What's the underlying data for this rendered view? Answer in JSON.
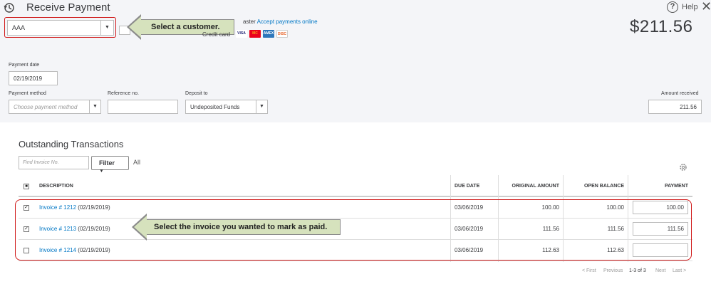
{
  "header": {
    "title": "Receive Payment",
    "help_label": "Help",
    "close_symbol": "✕",
    "amount_display": "$211.56"
  },
  "customer": {
    "value": "AAA",
    "callout": "Select a customer."
  },
  "payments_promo": {
    "partial_text": "aster",
    "link_text": "Accept payments online",
    "credit_card_label": "Credit card",
    "cards": [
      "VISA",
      "MC",
      "AMEX",
      "DISC"
    ]
  },
  "form": {
    "payment_date_label": "Payment date",
    "payment_date_value": "02/19/2019",
    "payment_method_label": "Payment method",
    "payment_method_placeholder": "Choose payment method",
    "reference_label": "Reference no.",
    "reference_value": "",
    "deposit_label": "Deposit to",
    "deposit_value": "Undeposited Funds",
    "amount_received_label": "Amount received",
    "amount_received_value": "211.56"
  },
  "outstanding": {
    "title": "Outstanding Transactions",
    "find_placeholder": "Find Invoice No.",
    "filter_label": "Filter",
    "all_label": "All",
    "columns": {
      "description": "DESCRIPTION",
      "due_date": "DUE DATE",
      "original_amount": "ORIGINAL AMOUNT",
      "open_balance": "OPEN BALANCE",
      "payment": "PAYMENT"
    },
    "rows": [
      {
        "invoice": "Invoice # 1212",
        "date": "(02/19/2019)",
        "due_date": "03/06/2019",
        "original": "100.00",
        "open": "100.00",
        "payment": "100.00",
        "checked": true
      },
      {
        "invoice": "Invoice # 1213",
        "date": "(02/19/2019)",
        "due_date": "03/06/2019",
        "original": "111.56",
        "open": "111.56",
        "payment": "111.56",
        "checked": true
      },
      {
        "invoice": "Invoice # 1214",
        "date": "(02/19/2019)",
        "due_date": "03/06/2019",
        "original": "112.63",
        "open": "112.63",
        "payment": "",
        "checked": false
      }
    ],
    "invoice_callout": "Select the invoice you wanted to mark as paid.",
    "pager": {
      "first": "< First",
      "previous": "Previous",
      "range": "1-3 of 3",
      "next": "Next",
      "last": "Last >"
    }
  },
  "colors": {
    "link": "#0077c5",
    "highlight": "#d01818",
    "callout_fill": "#d6e2bd"
  }
}
